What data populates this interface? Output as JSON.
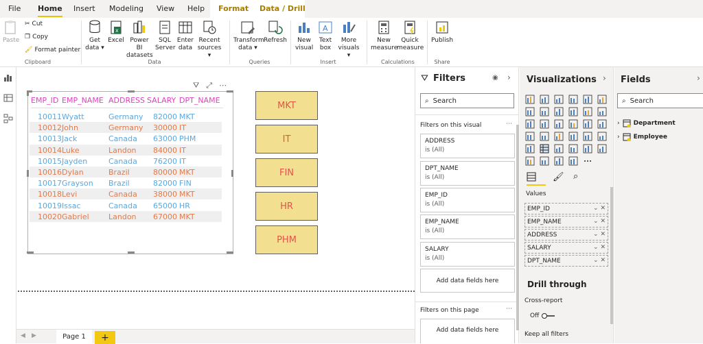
{
  "menu": {
    "tabs": [
      "File",
      "Home",
      "Insert",
      "Modeling",
      "View",
      "Help"
    ],
    "context_tabs": [
      "Format",
      "Data / Drill"
    ]
  },
  "ribbon": {
    "clipboard": {
      "paste": "Paste",
      "cut": "Cut",
      "copy": "Copy",
      "format_painter": "Format painter",
      "group": "Clipboard"
    },
    "data": {
      "get_data": [
        "Get",
        "data ▾"
      ],
      "excel": "Excel",
      "pbi": [
        "Power BI",
        "datasets"
      ],
      "sql": [
        "SQL",
        "Server"
      ],
      "enter": [
        "Enter",
        "data"
      ],
      "recent": [
        "Recent",
        "sources ▾"
      ],
      "group": "Data"
    },
    "queries": {
      "transform": [
        "Transform",
        "data ▾"
      ],
      "refresh": "Refresh",
      "group": "Queries"
    },
    "insert": {
      "new_visual": [
        "New",
        "visual"
      ],
      "text_box": [
        "Text",
        "box"
      ],
      "more_visuals": [
        "More",
        "visuals ▾"
      ],
      "group": "Insert"
    },
    "calculations": {
      "new_measure": [
        "New",
        "measure"
      ],
      "quick_measure": [
        "Quick",
        "measure"
      ],
      "group": "Calculations"
    },
    "share": {
      "publish": "Publish",
      "group": "Share"
    }
  },
  "table": {
    "columns": [
      "EMP_ID",
      "EMP_NAME",
      "ADDRESS",
      "SALARY",
      "DPT_NAME"
    ],
    "rows": [
      [
        "10011",
        "Wyatt",
        "Germany",
        "82000",
        "MKT"
      ],
      [
        "10012",
        "John",
        "Germany",
        "30000",
        "IT"
      ],
      [
        "10013",
        "Jack",
        "Canada",
        "63000",
        "PHM"
      ],
      [
        "10014",
        "Luke",
        "Landon",
        "84000",
        "IT"
      ],
      [
        "10015",
        "Jayden",
        "Canada",
        "76200",
        "IT"
      ],
      [
        "10016",
        "Dylan",
        "Brazil",
        "80000",
        "MKT"
      ],
      [
        "10017",
        "Grayson",
        "Brazil",
        "82000",
        "FIN"
      ],
      [
        "10018",
        "Levi",
        "Canada",
        "38000",
        "MKT"
      ],
      [
        "10019",
        "Issac",
        "Canada",
        "65000",
        "HR"
      ],
      [
        "10020",
        "Gabriel",
        "Landon",
        "67000",
        "MKT"
      ]
    ]
  },
  "departments": [
    "MKT",
    "IT",
    "FIN",
    "HR",
    "PHM"
  ],
  "filters": {
    "title": "Filters",
    "search_placeholder": "Search",
    "on_visual_label": "Filters on this visual",
    "cards": [
      {
        "field": "ADDRESS",
        "state": "is (All)"
      },
      {
        "field": "DPT_NAME",
        "state": "is (All)"
      },
      {
        "field": "EMP_ID",
        "state": "is (All)"
      },
      {
        "field": "EMP_NAME",
        "state": "is (All)"
      },
      {
        "field": "SALARY",
        "state": "is (All)"
      }
    ],
    "add_fields": "Add data fields here",
    "on_page_label": "Filters on this page",
    "page_add_fields": "Add data fields here"
  },
  "visualizations": {
    "title": "Visualizations",
    "values_label": "Values",
    "value_fields": [
      "EMP_ID",
      "EMP_NAME",
      "ADDRESS",
      "SALARY",
      "DPT_NAME"
    ],
    "drill_title": "Drill through",
    "cross_report": "Cross-report",
    "toggle_off": "Off",
    "keep_filters": "Keep all filters"
  },
  "fields": {
    "title": "Fields",
    "search_placeholder": "Search",
    "tables": [
      "Department",
      "Employee"
    ]
  },
  "pages": {
    "current": "Page 1",
    "add": "+"
  },
  "colors": {
    "accent": "#f2c811",
    "blue_text": "#5aa8e0",
    "orange_text": "#e07a4a",
    "header_text": "#e040c0",
    "dept_fill": "#f2df8f"
  }
}
